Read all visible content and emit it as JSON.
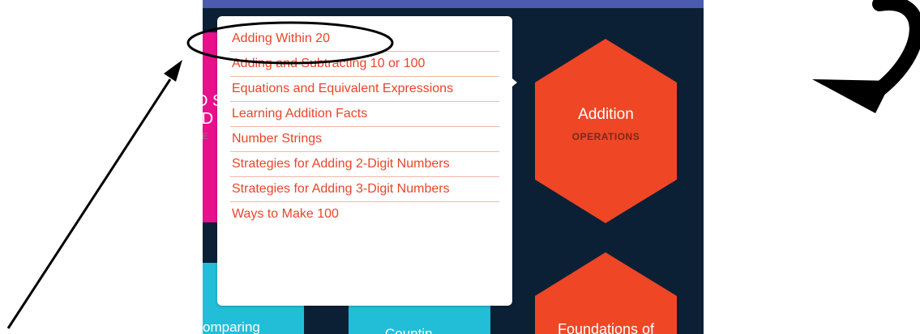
{
  "dropdown": {
    "items": [
      {
        "label": "Adding Within 20"
      },
      {
        "label": "Adding and Subtracting 10 or 100"
      },
      {
        "label": "Equations and Equivalent Expressions"
      },
      {
        "label": "Learning Addition Facts"
      },
      {
        "label": "Number Strings"
      },
      {
        "label": "Strategies for Adding 2-Digit Numbers"
      },
      {
        "label": "Strategies for Adding 3-Digit Numbers"
      },
      {
        "label": "Ways to Make 100"
      }
    ]
  },
  "tiles": {
    "addition": {
      "title": "Addition",
      "subtitle": "OPERATIONS"
    },
    "foundations": {
      "title": "Foundations of"
    },
    "comparing": {
      "title": "omparing"
    },
    "partial_left": {
      "line1": "D S",
      "line2": "-D",
      "line3": "SE"
    },
    "counting_partial": {
      "title": "Countin"
    }
  },
  "colors": {
    "panel_bg": "#0b2035",
    "top_bar": "#4a5bb0",
    "addition_hex": "#ef4626",
    "magenta_tile": "#e8108b",
    "cyan_tile": "#22bed8",
    "menu_text": "#e8452a"
  }
}
